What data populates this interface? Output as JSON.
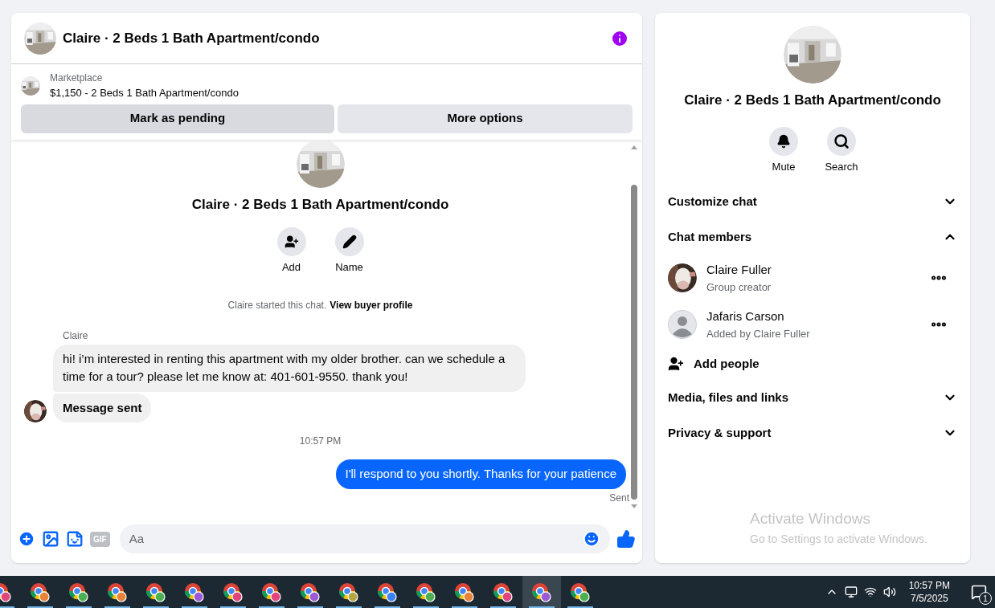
{
  "header": {
    "title": "Claire · 2 Beds 1 Bath Apartment/condo"
  },
  "listing": {
    "source": "Marketplace",
    "summary": "$1,150 - 2 Beds 1 Bath Apartment/condo",
    "buttons": [
      {
        "label": "Mark as pending",
        "kind": "primary"
      },
      {
        "label": "More options",
        "kind": "secondary"
      }
    ]
  },
  "chat_intro": {
    "title": "Claire · 2 Beds 1 Bath Apartment/condo",
    "actions": [
      {
        "label": "Add",
        "kind": "add-person"
      },
      {
        "label": "Name",
        "kind": "pencil"
      }
    ],
    "notice": "Claire started this chat.",
    "notice_link": "View buyer profile"
  },
  "messages": [
    {
      "kind": "received",
      "sender": "Claire",
      "text": "hi! i’m interested in renting this apartment with my older brother. can we schedule a time for a tour? please let me know at: 401-601-9550. thank you!",
      "emphasis": false,
      "avatar": false
    },
    {
      "kind": "received",
      "text": "Message sent",
      "emphasis": true,
      "avatar": true
    },
    {
      "kind": "timestamp",
      "text": "10:57 PM"
    },
    {
      "kind": "sent",
      "text": "I'll respond to you shortly. Thanks for your patience",
      "status": "Sent"
    }
  ],
  "composer": {
    "placeholder": "Aa",
    "gif_label": "GIF"
  },
  "details": {
    "title": "Claire · 2 Beds 1 Bath Apartment/condo",
    "actions": [
      {
        "label": "Mute",
        "kind": "bell"
      },
      {
        "label": "Search",
        "kind": "search"
      }
    ],
    "sections": [
      {
        "label": "Customize chat",
        "expanded": false
      },
      {
        "label": "Chat members",
        "expanded": true,
        "members": [
          {
            "name": "Claire Fuller",
            "role": "Group creator"
          },
          {
            "name": "Jafaris Carson",
            "role": "Added by Claire Fuller",
            "kind": "default"
          }
        ],
        "add_label": "Add people"
      },
      {
        "label": "Media, files and links",
        "expanded": false
      },
      {
        "label": "Privacy & support",
        "expanded": false
      }
    ]
  },
  "watermark": {
    "title": "Activate Windows",
    "subtitle": "Go to Settings to activate Windows."
  },
  "taskbar": {
    "apps": [
      {
        "color": "#e0457b",
        "selected": false
      },
      {
        "color": "#e8833a",
        "selected": false
      },
      {
        "color": "#4caf50",
        "selected": false
      },
      {
        "color": "#e8833a",
        "selected": false
      },
      {
        "color": "#4caf50",
        "selected": false
      },
      {
        "color": "#9c5bd6",
        "selected": false
      },
      {
        "color": "#e0457b",
        "selected": false
      },
      {
        "color": "#e0457b",
        "selected": false
      },
      {
        "color": "#9c5bd6",
        "selected": false
      },
      {
        "color": "#b5a642",
        "selected": false
      },
      {
        "color": "#3b82f6",
        "selected": false
      },
      {
        "color": "#4caf50",
        "selected": false
      },
      {
        "color": "#e8833a",
        "selected": false
      },
      {
        "color": "#e0457b",
        "selected": false
      },
      {
        "color": "#9c5bd6",
        "selected": true
      },
      {
        "color": "#4caf50",
        "selected": false
      }
    ],
    "time": "10:57 PM",
    "date": "7/5/2025",
    "notification_count": "1"
  }
}
